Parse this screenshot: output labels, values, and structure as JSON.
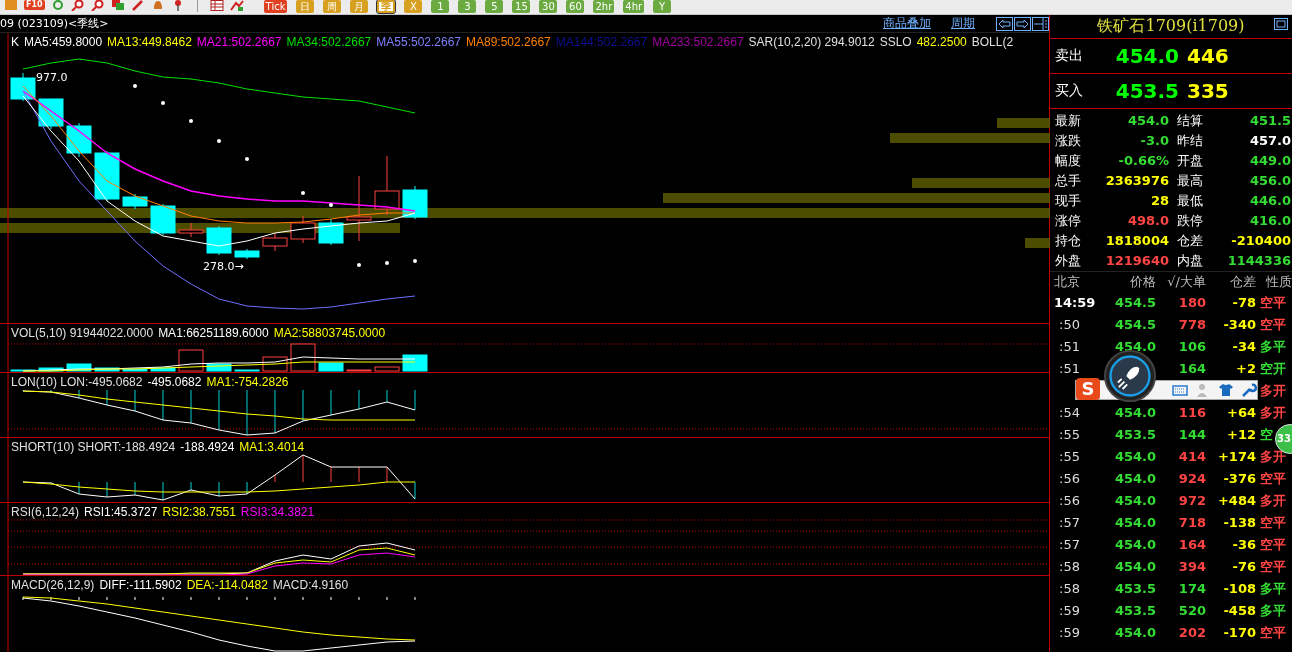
{
  "toolbar": {
    "f10_label": "F10",
    "periods": [
      {
        "label": "Tick",
        "selected": false,
        "color": "#e04020"
      },
      {
        "label": "日",
        "selected": false,
        "color": "#d8a020"
      },
      {
        "label": "周",
        "selected": false,
        "color": "#d8a020"
      },
      {
        "label": "月",
        "selected": false,
        "color": "#d8a020"
      },
      {
        "label": "季",
        "selected": true,
        "color": "#d8a020"
      },
      {
        "label": "X",
        "selected": false,
        "color": "#d8a020"
      },
      {
        "label": "1",
        "selected": false,
        "color": "#6aaa40"
      },
      {
        "label": "3",
        "selected": false,
        "color": "#6aaa40"
      },
      {
        "label": "5",
        "selected": false,
        "color": "#6aaa40"
      },
      {
        "label": "15",
        "selected": false,
        "color": "#6aaa40"
      },
      {
        "label": "30",
        "selected": false,
        "color": "#6aaa40"
      },
      {
        "label": "60",
        "selected": false,
        "color": "#6aaa40"
      },
      {
        "label": "2hr",
        "selected": false,
        "color": "#6aaa40"
      },
      {
        "label": "4hr",
        "selected": false,
        "color": "#6aaa40"
      },
      {
        "label": "Y",
        "selected": false,
        "color": "#6aaa40"
      }
    ]
  },
  "chart_header": {
    "title": "09 (023109)<季线>",
    "links": [
      "商品叠加",
      "周期"
    ]
  },
  "main_chart": {
    "legend": [
      {
        "text": "K",
        "color": "#ffffff"
      },
      {
        "text": "MA5:459.8000",
        "color": "#ffffff"
      },
      {
        "text": "MA13:449.8462",
        "color": "#ffff00"
      },
      {
        "text": "MA21:502.2667",
        "color": "#ff00ff"
      },
      {
        "text": "MA34:502.2667",
        "color": "#00e000"
      },
      {
        "text": "MA55:502.2667",
        "color": "#8080ff"
      },
      {
        "text": "MA89:502.2667",
        "color": "#ff8000"
      },
      {
        "text": "MA144:502.2667",
        "color": "#101090"
      },
      {
        "text": "MA233:502.2667",
        "color": "#a000a0"
      },
      {
        "text": "SAR(10,2,20) 294.9012",
        "color": "#e0e0e0"
      },
      {
        "text": "SSLO",
        "color": "#e0e0e0"
      },
      {
        "text": "482.2500",
        "color": "#ffff00"
      },
      {
        "text": "BOLL(2",
        "color": "#e0e0e0"
      }
    ],
    "high_label": "977.0",
    "low_label": "278.0→"
  },
  "indicators": [
    {
      "kind": "vol",
      "legend": [
        {
          "text": "VOL(5,10) 91944022.0000",
          "color": "#e0e0e0"
        },
        {
          "text": "MA1:66251189.6000",
          "color": "#ffffff"
        },
        {
          "text": "MA2:58803745.0000",
          "color": "#ffff00"
        }
      ]
    },
    {
      "kind": "lon",
      "legend": [
        {
          "text": "LON(10) LON:-495.0682",
          "color": "#e0e0e0"
        },
        {
          "text": "-495.0682",
          "color": "#ffffff"
        },
        {
          "text": "MA1:-754.2826",
          "color": "#ffff00"
        }
      ]
    },
    {
      "kind": "short",
      "legend": [
        {
          "text": "SHORT(10) SHORT:-188.4924",
          "color": "#e0e0e0"
        },
        {
          "text": "-188.4924",
          "color": "#ffffff"
        },
        {
          "text": "MA1:3.4014",
          "color": "#ffff00"
        }
      ]
    },
    {
      "kind": "rsi",
      "legend": [
        {
          "text": "RSI(6,12,24)",
          "color": "#e0e0e0"
        },
        {
          "text": "RSI1:45.3727",
          "color": "#ffffff"
        },
        {
          "text": "RSI2:38.7551",
          "color": "#ffff00"
        },
        {
          "text": "RSI3:34.3821",
          "color": "#ff00ff"
        }
      ]
    },
    {
      "kind": "macd",
      "legend": [
        {
          "text": "MACD(26,12,9)",
          "color": "#e0e0e0"
        },
        {
          "text": "DIFF:-111.5902",
          "color": "#ffffff"
        },
        {
          "text": "DEA:-114.0482",
          "color": "#ffff00"
        },
        {
          "text": "MACD:4.9160",
          "color": "#e0e0e0"
        }
      ]
    }
  ],
  "quote": {
    "title": "铁矿石1709(i1709)",
    "ask": {
      "label": "卖出",
      "price": "454.0",
      "volume": "446"
    },
    "bid": {
      "label": "买入",
      "price": "453.5",
      "volume": "335"
    },
    "stats": [
      {
        "label": "最新",
        "value": "454.0",
        "color": "#33dd33"
      },
      {
        "label": "结算",
        "value": "451.5",
        "color": "#33dd33"
      },
      {
        "label": "涨跌",
        "value": "-3.0",
        "color": "#33dd33"
      },
      {
        "label": "昨结",
        "value": "457.0",
        "color": "#ffffff"
      },
      {
        "label": "幅度",
        "value": "-0.66%",
        "color": "#33dd33"
      },
      {
        "label": "开盘",
        "value": "449.0",
        "color": "#33dd33"
      },
      {
        "label": "总手",
        "value": "2363976",
        "color": "#ffff00"
      },
      {
        "label": "最高",
        "value": "456.0",
        "color": "#33dd33"
      },
      {
        "label": "现手",
        "value": "28",
        "color": "#ffff00"
      },
      {
        "label": "最低",
        "value": "446.0",
        "color": "#33dd33"
      },
      {
        "label": "涨停",
        "value": "498.0",
        "color": "#ff4444"
      },
      {
        "label": "跌停",
        "value": "416.0",
        "color": "#33dd33"
      },
      {
        "label": "持仓",
        "value": "1818004",
        "color": "#ffff00"
      },
      {
        "label": "仓差",
        "value": "-210400",
        "color": "#ffff00"
      },
      {
        "label": "外盘",
        "value": "1219640",
        "color": "#ff4444"
      },
      {
        "label": "内盘",
        "value": "1144336",
        "color": "#33dd33"
      }
    ]
  },
  "ticks": {
    "columns": [
      "北京",
      "价格",
      "√/大单",
      "仓差",
      "性质"
    ],
    "rows": [
      {
        "time": "14:59",
        "price": "454.5",
        "volume": {
          "text": "180",
          "color": "#ff4444"
        },
        "change": "-78",
        "nature": {
          "text": "空平",
          "color": "#ff4444"
        }
      },
      {
        "time": ":50",
        "price": "454.5",
        "volume": {
          "text": "778",
          "color": "#ff4444"
        },
        "change": "-340",
        "nature": {
          "text": "空平",
          "color": "#ff4444"
        }
      },
      {
        "time": ":51",
        "price": "454.0",
        "volume": {
          "text": "106",
          "color": "#33dd33"
        },
        "change": "-34",
        "nature": {
          "text": "多平",
          "color": "#33dd33"
        }
      },
      {
        "time": ":51",
        "volume": {
          "text": "164",
          "color": "#33dd33"
        },
        "change": "+2",
        "nature": {
          "text": "空开",
          "color": "#33dd33"
        }
      },
      {
        "nature": {
          "text": "多开",
          "color": "#ff4444"
        }
      },
      {
        "time": ":54",
        "price": "454.0",
        "volume": {
          "text": "116",
          "color": "#ff4444"
        },
        "change": "+64",
        "nature": {
          "text": "多开",
          "color": "#ff4444"
        }
      },
      {
        "time": ":55",
        "price": "453.5",
        "volume": {
          "text": "144",
          "color": "#33dd33"
        },
        "change": "+12",
        "nature": {
          "text": "空",
          "color": "#33dd33"
        }
      },
      {
        "time": ":55",
        "price": "454.0",
        "volume": {
          "text": "414",
          "color": "#ff4444"
        },
        "change": "+174",
        "nature": {
          "text": "多开",
          "color": "#ff4444"
        }
      },
      {
        "time": ":56",
        "price": "454.0",
        "volume": {
          "text": "924",
          "color": "#ff4444"
        },
        "change": "-376",
        "nature": {
          "text": "空平",
          "color": "#ff4444"
        }
      },
      {
        "time": ":56",
        "price": "454.0",
        "volume": {
          "text": "972",
          "color": "#ff4444"
        },
        "change": "+484",
        "nature": {
          "text": "多开",
          "color": "#ff4444"
        }
      },
      {
        "time": ":57",
        "price": "454.0",
        "volume": {
          "text": "718",
          "color": "#ff4444"
        },
        "change": "-138",
        "nature": {
          "text": "空平",
          "color": "#ff4444"
        }
      },
      {
        "time": ":57",
        "price": "454.0",
        "volume": {
          "text": "164",
          "color": "#ff4444"
        },
        "change": "-36",
        "nature": {
          "text": "空平",
          "color": "#ff4444"
        }
      },
      {
        "time": ":58",
        "price": "454.0",
        "volume": {
          "text": "394",
          "color": "#ff4444"
        },
        "change": "-76",
        "nature": {
          "text": "空平",
          "color": "#ff4444"
        }
      },
      {
        "time": ":58",
        "price": "453.5",
        "volume": {
          "text": "174",
          "color": "#33dd33"
        },
        "change": "-108",
        "nature": {
          "text": "多平",
          "color": "#33dd33"
        }
      },
      {
        "time": ":59",
        "price": "453.5",
        "volume": {
          "text": "520",
          "color": "#33dd33"
        },
        "change": "-458",
        "nature": {
          "text": "多平",
          "color": "#33dd33"
        }
      },
      {
        "time": ":59",
        "price": "454.0",
        "volume": {
          "text": "202",
          "color": "#ff4444"
        },
        "change": "-170",
        "nature": {
          "text": "空平",
          "color": "#ff4444"
        }
      }
    ]
  },
  "overlay": {
    "ime_logo": "S",
    "bubble": "33"
  }
}
